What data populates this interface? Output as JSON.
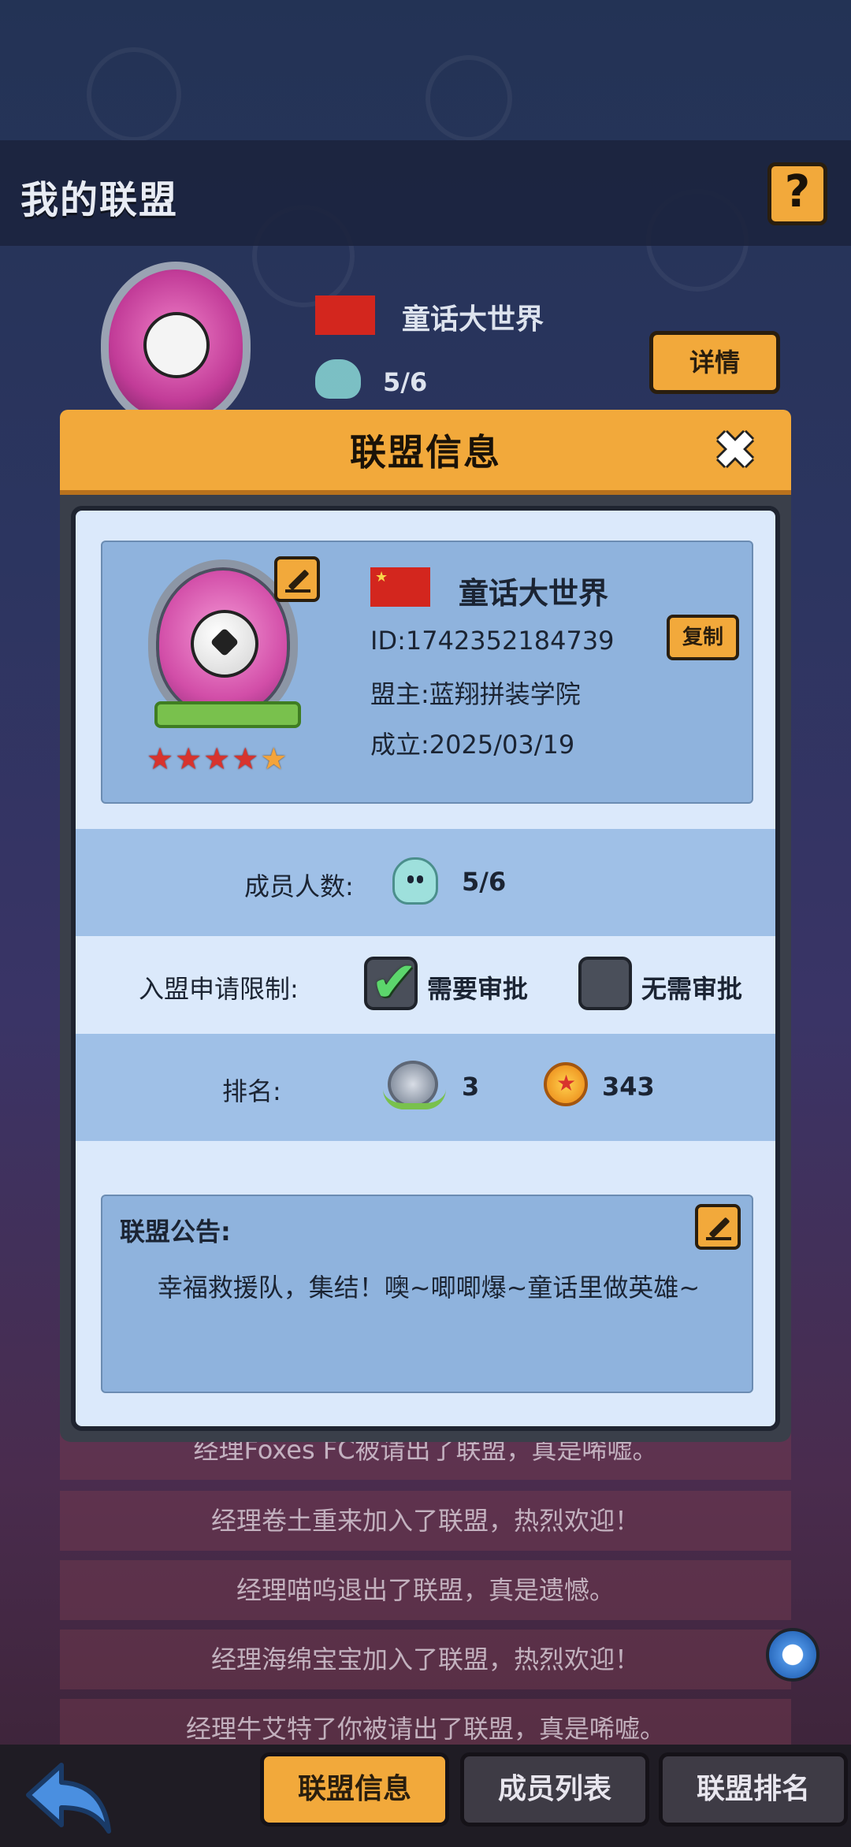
{
  "header": {
    "title": "我的联盟",
    "help_label": "?"
  },
  "background_league": {
    "name": "童话大世界",
    "members": "5/6",
    "details_label": "详情"
  },
  "log_rows": [
    "经理Foxes FC被请出了联盟，真是唏嘘。",
    "经理卷土重来加入了联盟，热烈欢迎！",
    "经理喵呜退出了联盟，真是遗憾。",
    "经理海绵宝宝加入了联盟，热烈欢迎！",
    "经理牛艾特了你被请出了联盟，真是唏嘘。"
  ],
  "modal": {
    "title": "联盟信息",
    "close_icon": "close-icon",
    "league": {
      "name": "童话大世界",
      "id_text": "ID:1742352184739",
      "copy_label": "复制",
      "leader_text": "盟主:蓝翔拼装学院",
      "founded_text": "成立:2025/03/19",
      "stars": 5
    },
    "members": {
      "label": "成员人数:",
      "value": "5/6"
    },
    "join_limit": {
      "label": "入盟申请限制:",
      "options": [
        {
          "label": "需要审批",
          "checked": true
        },
        {
          "label": "无需审批",
          "checked": false
        }
      ]
    },
    "ranking": {
      "label": "排名:",
      "rank_value": "3",
      "points_value": "343"
    },
    "notice": {
      "title": "联盟公告:",
      "text": "幸福救援队，集结！噢~唧唧爆~童话里做英雄~"
    }
  },
  "bottom_tabs": [
    {
      "label": "联盟信息",
      "active": true
    },
    {
      "label": "成员列表",
      "active": false
    },
    {
      "label": "联盟排名",
      "active": false
    }
  ],
  "colors": {
    "accent": "#f2a93b",
    "panel": "#dbe9fb",
    "card": "#8fb3dd"
  }
}
